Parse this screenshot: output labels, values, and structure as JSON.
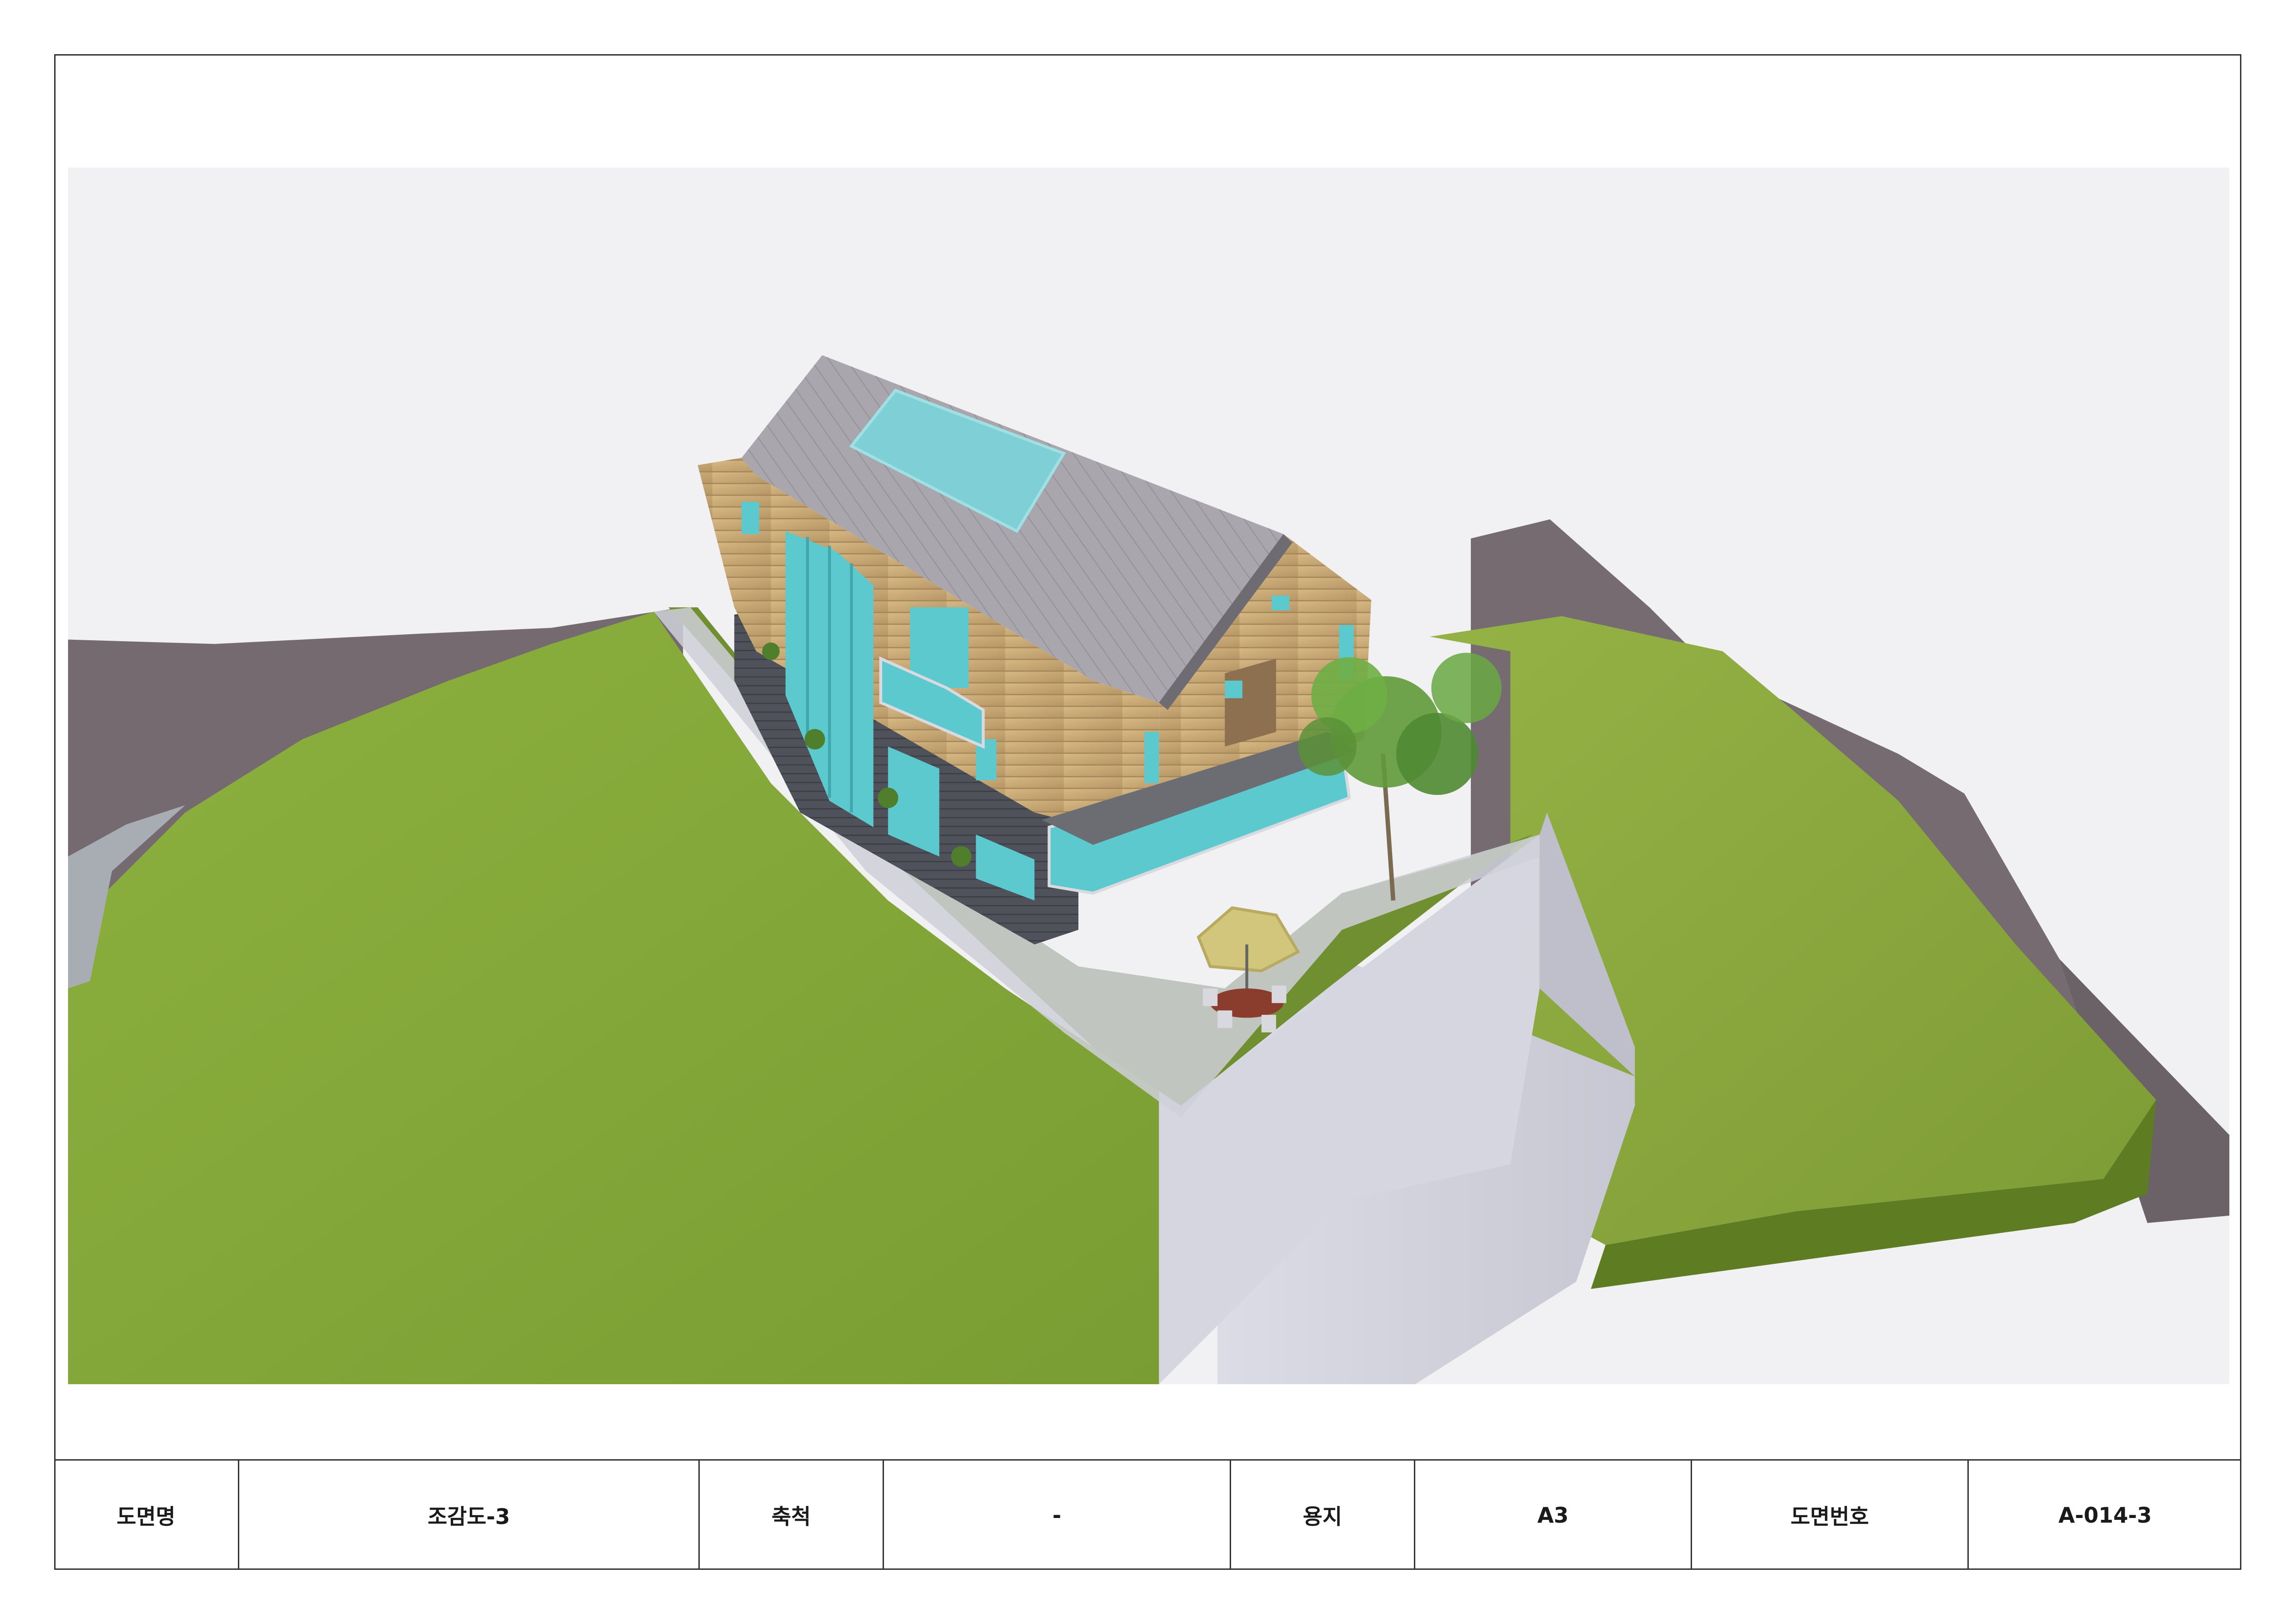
{
  "title_block": {
    "drawing_name_label": "도면명",
    "drawing_name_value": "조감도-3",
    "scale_label": "축척",
    "scale_value": "-",
    "paper_label": "용지",
    "paper_value": "A3",
    "drawing_number_label": "도면번호",
    "drawing_number_value": "A-014-3"
  },
  "colors": {
    "frame": "#333333",
    "sky": "#f1f0f2",
    "grass": "#8fae3e",
    "grass_shadow": "#5f7f24",
    "retaining_wall": "#d3d3df",
    "terrain": "#756b70",
    "roof": "#a8a4ab",
    "wood_cladding": "#c9a874",
    "glass": "#5cc9cf",
    "brick": "#4d5058",
    "umbrella": "#cfc37a"
  }
}
